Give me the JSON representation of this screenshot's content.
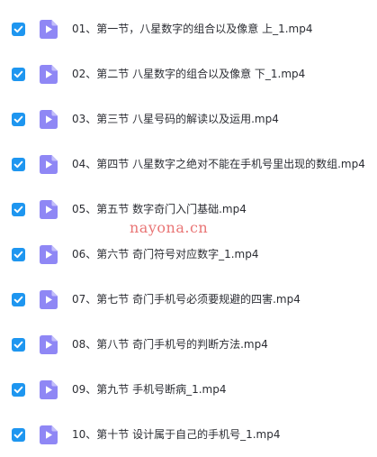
{
  "colors": {
    "checkbox": "#1e96f0",
    "video_icon": "#8f87f5",
    "text": "#2b2d33",
    "watermark": "#dc1e1e"
  },
  "icons": {
    "checkbox": "checkmark-icon",
    "file": "video-file-icon"
  },
  "files": [
    {
      "name": "01、第一节，八星数字的组合以及像意 上_1.mp4",
      "checked": true
    },
    {
      "name": "02、第二节 八星数字的组合以及像意 下_1.mp4",
      "checked": true
    },
    {
      "name": "03、第三节 八星号码的解读以及运用.mp4",
      "checked": true
    },
    {
      "name": "04、第四节 八星数字之绝对不能在手机号里出现的数组.mp4",
      "checked": true
    },
    {
      "name": "05、第五节 数字奇门入门基础.mp4",
      "checked": true
    },
    {
      "name": "06、第六节 奇门符号对应数字_1.mp4",
      "checked": true
    },
    {
      "name": "07、第七节 奇门手机号必须要规避的四害.mp4",
      "checked": true
    },
    {
      "name": "08、第八节 奇门手机号的判断方法.mp4",
      "checked": true
    },
    {
      "name": "09、第九节 手机号断病_1.mp4",
      "checked": true
    },
    {
      "name": "10、第十节 设计属于自己的手机号_1.mp4",
      "checked": true
    }
  ],
  "watermark": "nayona.cn"
}
